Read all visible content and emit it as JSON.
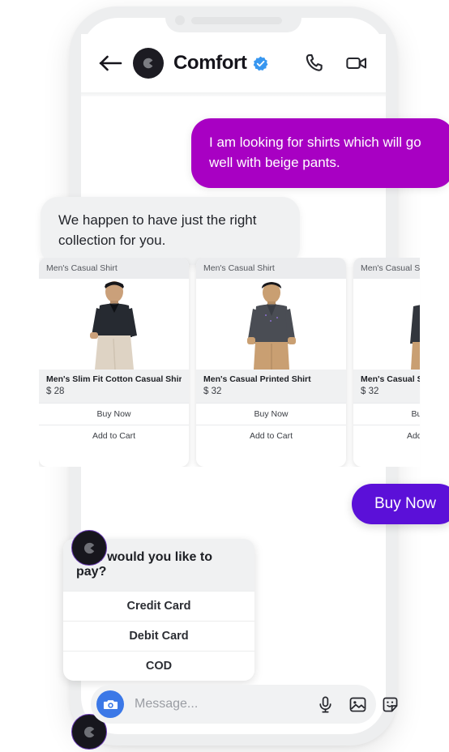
{
  "device": {
    "notch_camera": "camera-dot",
    "notch_speaker": "speaker-slot"
  },
  "header": {
    "back_icon": "back-arrow-icon",
    "avatar_icon": "brand-c-logo",
    "title": "Comfort",
    "verified_icon": "verified-badge-icon",
    "call_icon": "phone-icon",
    "video_icon": "video-camera-icon"
  },
  "messages": {
    "user": "I am looking for shirts which will go well with beige pants.",
    "bot": "We happen to have just the right collection for you."
  },
  "carousel": {
    "cards": [
      {
        "header": "Men's Casual Shirt",
        "title": "Men's Slim Fit Cotton Casual Shirt",
        "price": "$ 28",
        "buy_label": "Buy Now",
        "cart_label": "Add to Cart",
        "shirt_color": "#262a31",
        "pants_color": "#ded3c4"
      },
      {
        "header": "Men's Casual Shirt",
        "title": "Men's Casual Printed Shirt",
        "price": "$ 32",
        "buy_label": "Buy Now",
        "cart_label": "Add to Cart",
        "shirt_color": "#4a4d54",
        "pants_color": "#c59a6d"
      },
      {
        "header": "Men's Casual Shirt",
        "title": "Men's Casual Shirt",
        "price": "$ 32",
        "buy_label": "Buy Now",
        "cart_label": "Add to Cart",
        "shirt_color": "#32363d",
        "pants_color": "#c99f72"
      }
    ]
  },
  "buy_now_pill": {
    "label": "Buy Now"
  },
  "payment": {
    "question": "How would you like to pay?",
    "options": [
      "Credit Card",
      "Debit Card",
      "COD"
    ]
  },
  "side_badges": {
    "icon": "brand-c-logo"
  },
  "input_bar": {
    "camera_icon": "camera-icon",
    "placeholder": "Message...",
    "value": "",
    "mic_icon": "microphone-icon",
    "gallery_icon": "image-icon",
    "sticker_icon": "sticker-icon"
  },
  "colors": {
    "user_bubble": "#a800c3",
    "bot_bubble": "#f0f1f2",
    "buy_pill": "#5b10d8",
    "verified_blue": "#3897f0",
    "camera_blue": "#3b78e7",
    "phone_frame": "#edeeef"
  }
}
